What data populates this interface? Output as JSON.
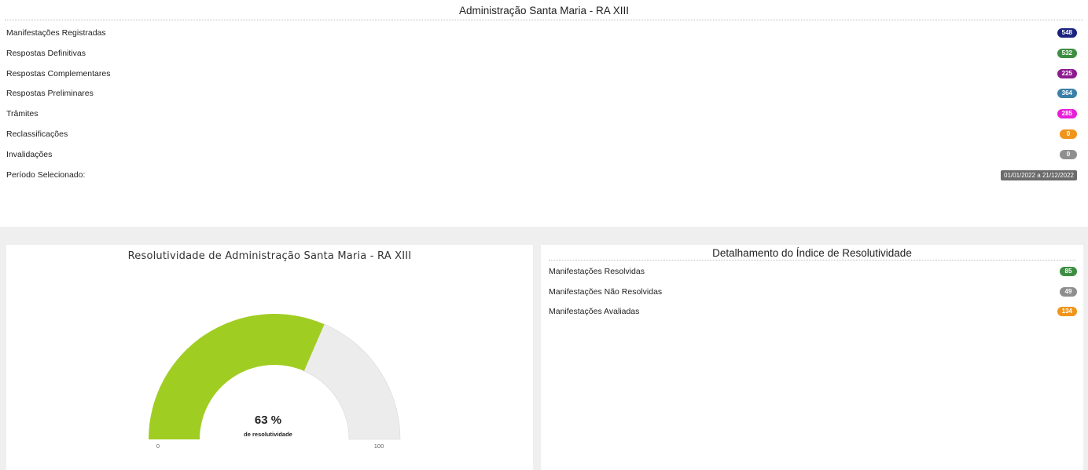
{
  "top": {
    "title": "Administração Santa Maria - RA XIII",
    "rows": [
      {
        "label": "Manifestações Registradas",
        "value": "548",
        "color": "#1a237e"
      },
      {
        "label": "Respostas Definitivas",
        "value": "532",
        "color": "#3e8e41"
      },
      {
        "label": "Respostas Complementares",
        "value": "225",
        "color": "#8e1a8e"
      },
      {
        "label": "Respostas Preliminares",
        "value": "364",
        "color": "#3b7fa8"
      },
      {
        "label": "Trâmites",
        "value": "285",
        "color": "#e91ed8"
      },
      {
        "label": "Reclassificações",
        "value": "0",
        "color": "#f0941a"
      },
      {
        "label": "Invalidações",
        "value": "0",
        "color": "#8f8f8f"
      }
    ],
    "period": {
      "label": "Período Selecionado:",
      "value": "01/01/2022 a 21/12/2022",
      "color": "#6b6b6b"
    }
  },
  "gauge": {
    "title": "Resolutividade de Administração Santa Maria - RA XIII",
    "value_text": "63 %",
    "caption": "de resolutividade",
    "min_label": "0",
    "max_label": "100",
    "fraction": 0.63,
    "fill_color": "#a0cd22",
    "track_color": "#ececec"
  },
  "detail": {
    "title": "Detalhamento do Índice de Resolutividade",
    "rows": [
      {
        "label": "Manifestações Resolvidas",
        "value": "85",
        "color": "#3e8e41"
      },
      {
        "label": "Manifestações Não Resolvidas",
        "value": "49",
        "color": "#8f8f8f"
      },
      {
        "label": "Manifestações Avaliadas",
        "value": "134",
        "color": "#f0941a"
      }
    ]
  }
}
